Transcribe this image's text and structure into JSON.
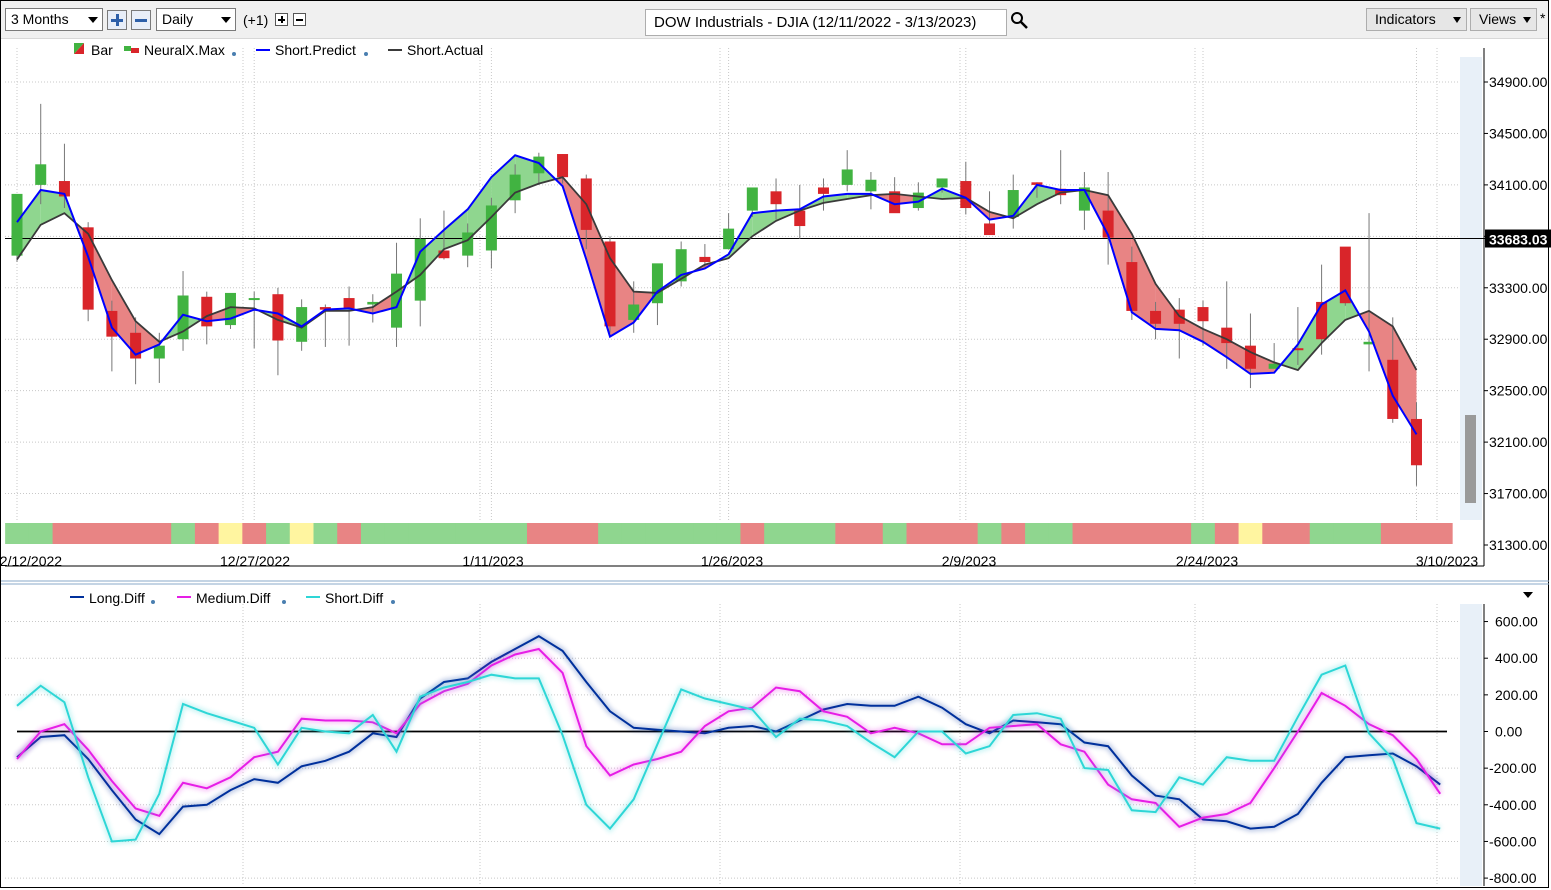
{
  "toolbar": {
    "period": "3 Months",
    "interval": "Daily",
    "offset": "(+1)",
    "title": "DOW Industrials - DJIA (12/11/2022 - 3/13/2023)",
    "indicators": "Indicators",
    "views": "Views",
    "views_star": "*"
  },
  "price_pane": {
    "legend": [
      "Bar",
      "NeuralX.Max",
      "Short.Predict",
      "Short.Actual"
    ],
    "current_price": "33683.03",
    "y_ticks": [
      "34900.00",
      "34500.00",
      "34100.00",
      "33700.00",
      "33300.00",
      "32900.00",
      "32500.00",
      "32100.00",
      "31700.00",
      "31300.00"
    ],
    "x_labels": [
      "12/12/2022",
      "12/27/2022",
      "1/11/2023",
      "1/26/2023",
      "2/9/2023",
      "2/24/2023",
      "3/10/2023"
    ]
  },
  "diff_pane": {
    "legend": [
      "Long.Diff",
      "Medium.Diff",
      "Short.Diff"
    ],
    "y_ticks": [
      "600.00",
      "400.00",
      "200.00",
      "0.00",
      "-200.00",
      "-400.00",
      "-600.00",
      "-800.00"
    ]
  },
  "colors": {
    "up_candle": "#41b341",
    "down_candle": "#d9252a",
    "predict_line": "#0000ff",
    "actual_line": "#3a3a3a",
    "long_diff": "#00309c",
    "medium_diff": "#e61ee6",
    "short_diff": "#2ed6d6",
    "band_green": "#8fd68f",
    "band_red": "#e88484",
    "band_yellow": "#fff5a0"
  },
  "chart_data": [
    {
      "type": "candlestick",
      "ylim": [
        31300,
        35100
      ],
      "reference_line": 33683.03,
      "dates": [
        "12/12/2022",
        "12/13",
        "12/14",
        "12/15",
        "12/16",
        "12/19",
        "12/20",
        "12/21",
        "12/22",
        "12/23",
        "12/27",
        "12/28",
        "12/29",
        "12/30",
        "1/3",
        "1/4",
        "1/5",
        "1/6",
        "1/9",
        "1/10",
        "1/11",
        "1/12",
        "1/13",
        "1/17",
        "1/18",
        "1/19",
        "1/20",
        "1/23",
        "1/24",
        "1/25",
        "1/26",
        "1/27",
        "1/30",
        "1/31",
        "2/1",
        "2/2",
        "2/3",
        "2/6",
        "2/7",
        "2/8",
        "2/9",
        "2/10",
        "2/13",
        "2/14",
        "2/15",
        "2/16",
        "2/17",
        "2/21",
        "2/22",
        "2/23",
        "2/24",
        "2/27",
        "2/28",
        "3/1",
        "3/2",
        "3/3",
        "3/6",
        "3/7",
        "3/8",
        "3/9",
        "3/10"
      ],
      "open": [
        33550,
        34100,
        34130,
        33770,
        33120,
        32950,
        32750,
        32900,
        33230,
        33010,
        33220,
        33250,
        32880,
        33150,
        33220,
        33170,
        32990,
        33200,
        33590,
        33550,
        33590,
        33980,
        34190,
        34340,
        34150,
        33660,
        33050,
        33180,
        33350,
        33540,
        33600,
        33900,
        34050,
        33900,
        34080,
        34100,
        34050,
        34050,
        33920,
        34080,
        34130,
        33800,
        33850,
        34120,
        34070,
        33900,
        33900,
        33500,
        33120,
        33130,
        33150,
        32990,
        32850,
        32670,
        32830,
        33190,
        33620,
        32860,
        32740,
        32280
      ],
      "close": [
        34030,
        34260,
        34010,
        33130,
        32920,
        32750,
        32850,
        33240,
        33000,
        33260,
        33220,
        32890,
        33150,
        33130,
        33140,
        33190,
        33410,
        33680,
        33530,
        33730,
        33940,
        34180,
        34320,
        34160,
        33750,
        33000,
        33170,
        33490,
        33600,
        33500,
        33760,
        34080,
        33950,
        33780,
        34030,
        34220,
        34140,
        33880,
        34040,
        34150,
        33920,
        33710,
        34060,
        34100,
        34020,
        34080,
        33690,
        33120,
        33020,
        33020,
        33040,
        32870,
        32670,
        32710,
        32820,
        32900,
        33180,
        32880,
        32280,
        31920
      ],
      "high": [
        33650,
        34730,
        34420,
        33810,
        33200,
        33070,
        32950,
        33430,
        33270,
        33250,
        33270,
        33300,
        33210,
        33170,
        33310,
        33250,
        33650,
        33840,
        33900,
        33800,
        34000,
        34260,
        34350,
        34340,
        34180,
        33700,
        33350,
        33380,
        33660,
        33640,
        33880,
        34020,
        34150,
        34100,
        34150,
        34370,
        34200,
        34160,
        34120,
        34150,
        34280,
        34050,
        34180,
        34120,
        34370,
        34200,
        34200,
        33620,
        33190,
        33220,
        33200,
        33350,
        33100,
        32870,
        33150,
        33480,
        33560,
        33880,
        33070,
        32410
      ],
      "low": [
        33500,
        33950,
        33920,
        33040,
        32650,
        32550,
        32560,
        32810,
        32860,
        32980,
        32830,
        32620,
        32810,
        32840,
        32850,
        33030,
        32840,
        33000,
        33520,
        33460,
        33450,
        33880,
        34100,
        34110,
        33600,
        32950,
        32950,
        33010,
        33310,
        33460,
        33600,
        33850,
        33830,
        33680,
        33900,
        34050,
        33910,
        33900,
        33900,
        34040,
        33870,
        33720,
        33760,
        34000,
        33950,
        33750,
        33480,
        33050,
        32900,
        32750,
        32850,
        32670,
        32520,
        32680,
        32700,
        32780,
        33160,
        32650,
        32250,
        31760
      ],
      "short_predict": [
        33810,
        34060,
        34030,
        33540,
        32990,
        32780,
        32860,
        33090,
        33040,
        33060,
        33130,
        33100,
        33000,
        33130,
        33140,
        33100,
        33150,
        33580,
        33750,
        33910,
        34160,
        34330,
        34270,
        34090,
        33520,
        32920,
        33030,
        33270,
        33400,
        33450,
        33560,
        33880,
        33900,
        33910,
        34010,
        34030,
        34030,
        33950,
        33970,
        34070,
        34000,
        33830,
        33860,
        34100,
        34060,
        34060,
        33710,
        33110,
        32980,
        32970,
        32880,
        32760,
        32630,
        32640,
        32860,
        33170,
        33280,
        32960,
        32460,
        32160
      ],
      "short_actual": [
        33520,
        33790,
        33880,
        33720,
        33360,
        33040,
        32880,
        32960,
        33080,
        33150,
        33140,
        33050,
        32990,
        33120,
        33120,
        33150,
        33270,
        33400,
        33600,
        33670,
        33850,
        34040,
        34110,
        34160,
        33950,
        33530,
        33270,
        33260,
        33370,
        33480,
        33530,
        33700,
        33820,
        33900,
        33960,
        33990,
        34020,
        34030,
        34010,
        33990,
        34000,
        33890,
        33840,
        33950,
        34040,
        34060,
        34020,
        33720,
        33330,
        33080,
        32980,
        32900,
        32800,
        32720,
        32660,
        32870,
        33050,
        33120,
        33000,
        32660
      ],
      "neuralx_bands": [
        "green",
        "green",
        "red",
        "red",
        "red",
        "red",
        "red",
        "green",
        "red",
        "yellow",
        "red",
        "green",
        "yellow",
        "green",
        "red",
        "green",
        "green",
        "green",
        "green",
        "green",
        "green",
        "green",
        "red",
        "red",
        "red",
        "green",
        "green",
        "green",
        "green",
        "green",
        "green",
        "red",
        "green",
        "green",
        "green",
        "red",
        "red",
        "green",
        "red",
        "red",
        "red",
        "green",
        "red",
        "green",
        "green",
        "red",
        "red",
        "red",
        "red",
        "red",
        "green",
        "red",
        "yellow",
        "red",
        "red",
        "green",
        "green",
        "green",
        "red",
        "red",
        "red"
      ]
    },
    {
      "type": "line",
      "ylim": [
        -800,
        650
      ],
      "series": [
        {
          "name": "Long.Diff",
          "values": [
            -140,
            -30,
            -20,
            -150,
            -320,
            -480,
            -560,
            -410,
            -400,
            -320,
            -260,
            -280,
            -190,
            -160,
            -110,
            -10,
            -30,
            180,
            270,
            290,
            380,
            450,
            520,
            440,
            270,
            110,
            20,
            10,
            0,
            -10,
            20,
            30,
            0,
            60,
            120,
            150,
            140,
            140,
            190,
            130,
            40,
            -10,
            60,
            50,
            40,
            -60,
            -80,
            -240,
            -350,
            -370,
            -480,
            -490,
            -530,
            -520,
            -450,
            -280,
            -140,
            -130,
            -120,
            -190,
            -290
          ]
        },
        {
          "name": "Medium.Diff",
          "values": [
            -150,
            0,
            40,
            -100,
            -270,
            -420,
            -460,
            -280,
            -310,
            -250,
            -140,
            -110,
            70,
            60,
            60,
            50,
            -10,
            150,
            220,
            260,
            360,
            420,
            450,
            320,
            -80,
            -240,
            -180,
            -150,
            -110,
            30,
            110,
            130,
            240,
            220,
            110,
            80,
            -10,
            20,
            -10,
            -70,
            -70,
            20,
            30,
            40,
            -70,
            -110,
            -290,
            -370,
            -390,
            -520,
            -470,
            -450,
            -390,
            -200,
            0,
            210,
            140,
            40,
            -20,
            -150,
            -340
          ]
        },
        {
          "name": "Short.Diff",
          "values": [
            140,
            250,
            160,
            -250,
            -600,
            -590,
            -340,
            150,
            100,
            60,
            20,
            -180,
            20,
            0,
            -10,
            90,
            -110,
            190,
            240,
            270,
            310,
            290,
            290,
            -20,
            -400,
            -530,
            -370,
            -70,
            230,
            180,
            150,
            120,
            -30,
            70,
            60,
            30,
            -60,
            -140,
            0,
            0,
            -120,
            -80,
            90,
            100,
            70,
            -200,
            -210,
            -430,
            -440,
            -250,
            -290,
            -140,
            -160,
            -160,
            80,
            310,
            360,
            -10,
            -150,
            -500,
            -530
          ]
        }
      ]
    }
  ]
}
